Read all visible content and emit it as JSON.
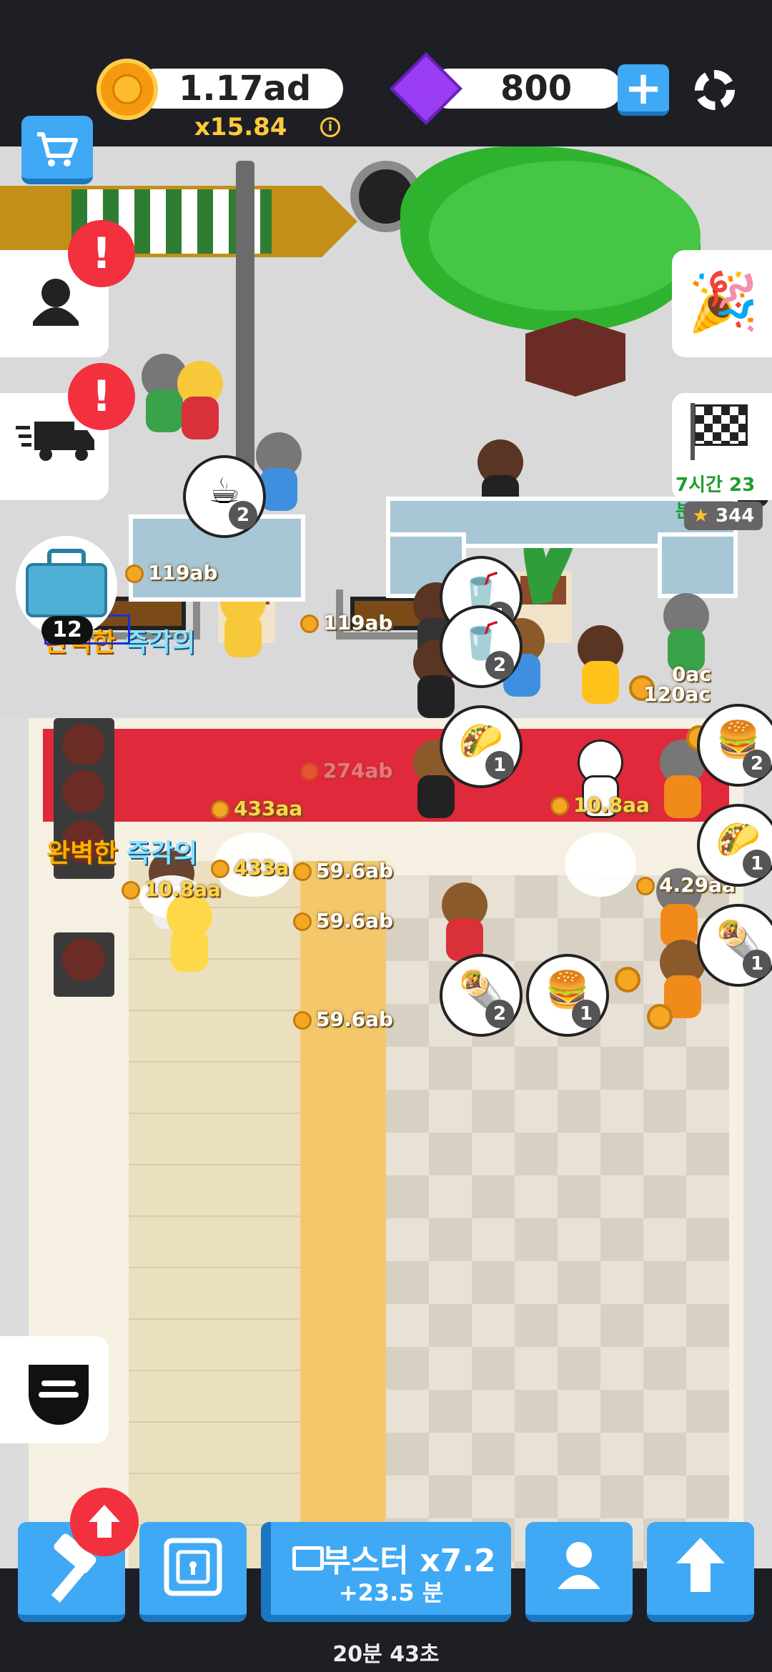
{
  "hud": {
    "coins": "1.17ad",
    "multiplier": "x15.84",
    "gems": "800",
    "icons": {
      "coin": "coin-icon",
      "gem": "gem-icon",
      "add": "plus-icon",
      "settings": "gear-icon",
      "info": "info-icon"
    }
  },
  "sidebar_left": {
    "shop_icon": "cart-icon",
    "staff_icon": "person-icon",
    "staff_alert": "!",
    "delivery_icon": "delivery-truck-icon",
    "delivery_alert": "!",
    "toolbox_count": "12",
    "menu_icon": "burger-menu-icon"
  },
  "sidebar_right": {
    "party_icon": "party-popper-icon",
    "event_icon": "checkered-flag-icon",
    "event_timer": "7시간 23분",
    "event_stars": "344"
  },
  "world": {
    "bubbles": [
      {
        "item": "coffee",
        "emoji": "☕",
        "count": "2"
      },
      {
        "item": "soda",
        "emoji": "🥤",
        "count": "1"
      },
      {
        "item": "soda",
        "emoji": "🥤",
        "count": "2"
      },
      {
        "item": "taco",
        "emoji": "🌮",
        "count": "1"
      },
      {
        "item": "burger",
        "emoji": "🍔",
        "count": "2"
      },
      {
        "item": "taco",
        "emoji": "🌮",
        "count": "1"
      },
      {
        "item": "wrap",
        "emoji": "🌯",
        "count": "1"
      },
      {
        "item": "wrap",
        "emoji": "🌯",
        "count": "2"
      },
      {
        "item": "burger",
        "emoji": "🍔",
        "count": "1"
      }
    ],
    "income_labels": [
      "119ab",
      "119ab",
      "120ac",
      "0ac",
      "274ab",
      "433aa",
      "10.8aa",
      "433a",
      "59.6ab",
      "10.8aa",
      "59.6ab",
      "4.29aa",
      "59.6ab"
    ],
    "perfect_texts": [
      {
        "a": "완벽한",
        "b": "즉각의"
      },
      {
        "a": "완벽한",
        "b": "즉각의"
      }
    ]
  },
  "bottom_bar": {
    "hammer_icon": "hammer-icon",
    "hammer_badge_icon": "arrow-up-icon",
    "safe_icon": "safe-icon",
    "booster_label": "부스터 x7.2",
    "booster_sub": "+23.5 분",
    "booster_icon": "video-ad-icon",
    "profile_icon": "person-icon",
    "upgrade_icon": "arrow-up-icon",
    "timer": "20분 43초"
  },
  "colors": {
    "accent_blue": "#3fa9f5",
    "alert_red": "#f2303e",
    "coin_gold": "#ffc93c",
    "wall_red": "#e0293a"
  }
}
